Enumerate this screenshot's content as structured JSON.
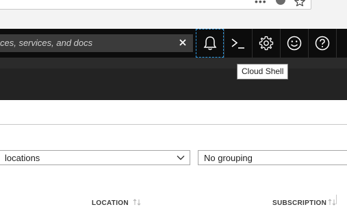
{
  "topbar": {
    "search_placeholder": "Search resources, services, and docs",
    "search_visible_text": "ces, services, and docs",
    "buttons": [
      "notifications",
      "cloud-shell",
      "settings",
      "feedback",
      "help"
    ]
  },
  "tooltip": {
    "text": "Cloud Shell"
  },
  "filters": {
    "location_value": "All locations",
    "location_visible_text": "locations",
    "grouping_value": "No grouping"
  },
  "table": {
    "columns": [
      {
        "label": "LOCATION"
      },
      {
        "label": "SUBSCRIPTION"
      }
    ]
  },
  "colors": {
    "topbar_bg": "#0c0c0c",
    "search_bg": "#3b3b3b",
    "focus_outline": "#2d9be6",
    "bar2_bg": "#2b2b2b",
    "bar3_bg": "#232323"
  }
}
